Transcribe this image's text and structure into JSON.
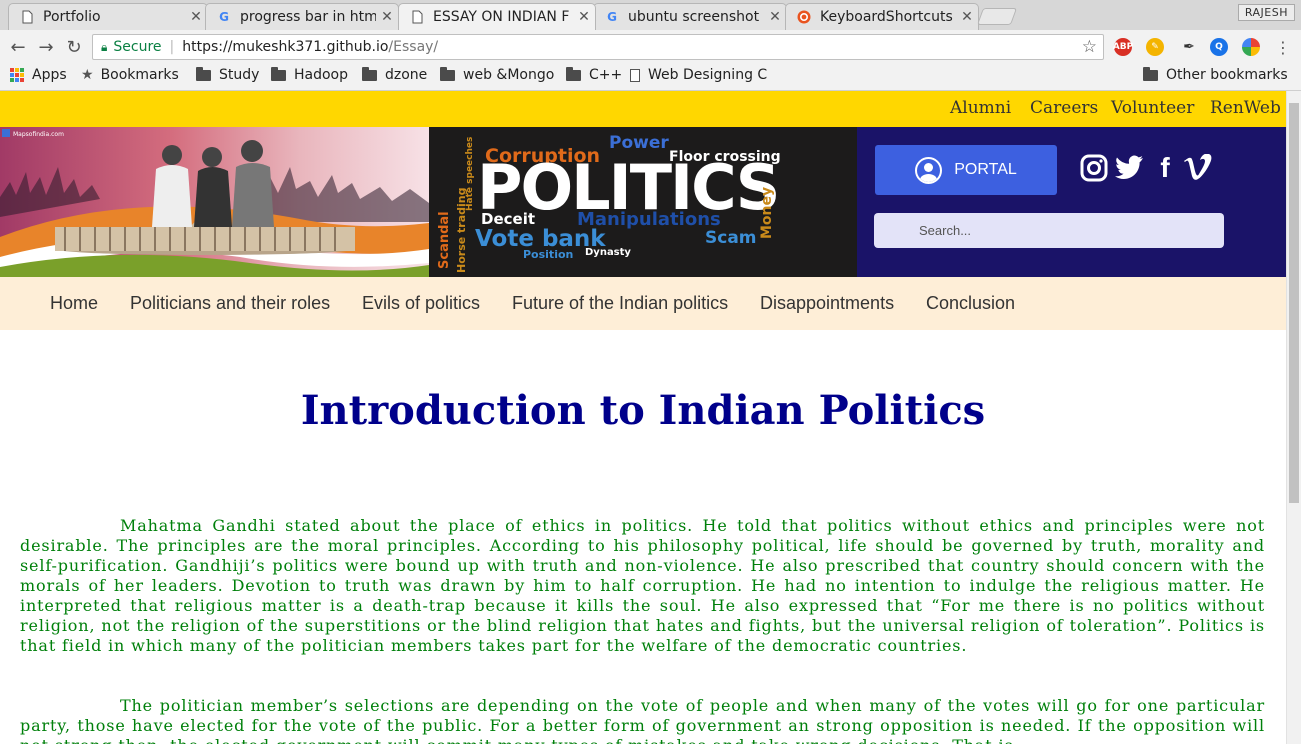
{
  "browser": {
    "tabs": [
      {
        "title": "Portfolio",
        "icon": "document-icon"
      },
      {
        "title": "progress bar in htm",
        "icon": "google-icon"
      },
      {
        "title": "ESSAY ON INDIAN F",
        "icon": "document-icon"
      },
      {
        "title": "ubuntu screenshot",
        "icon": "google-icon"
      },
      {
        "title": "KeyboardShortcuts",
        "icon": "ubuntu-icon"
      }
    ],
    "profile_name": "RAJESH",
    "address": {
      "secure_label": "Secure",
      "url_host": "https://mukeshk371.github.io",
      "url_path": "/Essay/"
    },
    "bookmarks": [
      {
        "label": "Apps",
        "icon": "apps-grid-icon"
      },
      {
        "label": "Bookmarks",
        "icon": "star-icon"
      },
      {
        "label": "Study",
        "icon": "folder-icon"
      },
      {
        "label": "Hadoop",
        "icon": "folder-icon"
      },
      {
        "label": "dzone",
        "icon": "folder-icon"
      },
      {
        "label": "web &Mongo",
        "icon": "folder-icon"
      },
      {
        "label": "C++",
        "icon": "folder-icon"
      },
      {
        "label": "Web Designing C",
        "icon": "file-icon"
      }
    ],
    "other_bookmarks": "Other bookmarks"
  },
  "site": {
    "top_links": [
      "Alumni",
      "Careers",
      "Volunteer",
      "RenWeb"
    ],
    "banner_left_caption": "Mapsofindia.com",
    "banner_words": {
      "main": "POLITICS",
      "words": [
        "Power",
        "Corruption",
        "Floor crossing",
        "Deceit",
        "Manipulations",
        "Vote bank",
        "Scam",
        "Money",
        "Scandal",
        "Horse trading",
        "Hate speeches",
        "Position",
        "Dynasty"
      ]
    },
    "portal_label": "PORTAL",
    "social": [
      "instagram-icon",
      "twitter-icon",
      "facebook-icon",
      "vimeo-icon"
    ],
    "search_placeholder": "Search...",
    "menu": [
      "Home",
      "Politicians and their roles",
      "Evils of politics",
      "Future of the Indian politics",
      "Disappointments",
      "Conclusion"
    ],
    "heading": "Introduction to Indian Politics",
    "paragraphs": [
      "Mahatma Gandhi stated about the place of ethics in politics. He told that politics without ethics and principles were not desirable. The principles are the moral principles. According to his philosophy political, life should be governed by truth, morality and self-purification. Gandhiji’s politics were bound up with truth and non-violence. He also prescribed that country should concern with the morals of her leaders. Devotion to truth was drawn by him to half corruption. He had no intention to indulge the religious matter. He interpreted that religious matter is a death-trap because it kills the soul. He also expressed that “For me there is no politics without religion, not the religion of the superstitions or the blind religion that hates and fights, but the universal religion of toleration”. Politics is that field in which many of the politician members takes part for the welfare of the democratic countries.",
      "The politician member’s selections are depending on the vote of people and when many of the votes will go for one particular party, those have elected for the vote of the public. For a better form of government an strong opposition is needed. If the opposition will not strong then, the elected government will commit many types of mistakes and take wrong decisions. That is"
    ]
  },
  "colors": {
    "topbar": "#ffd700",
    "banner_right": "#1a1368",
    "portal_button": "#3d60e0",
    "menu_bg": "#feeed7",
    "heading": "#00008b",
    "paragraph": "#00800b"
  }
}
